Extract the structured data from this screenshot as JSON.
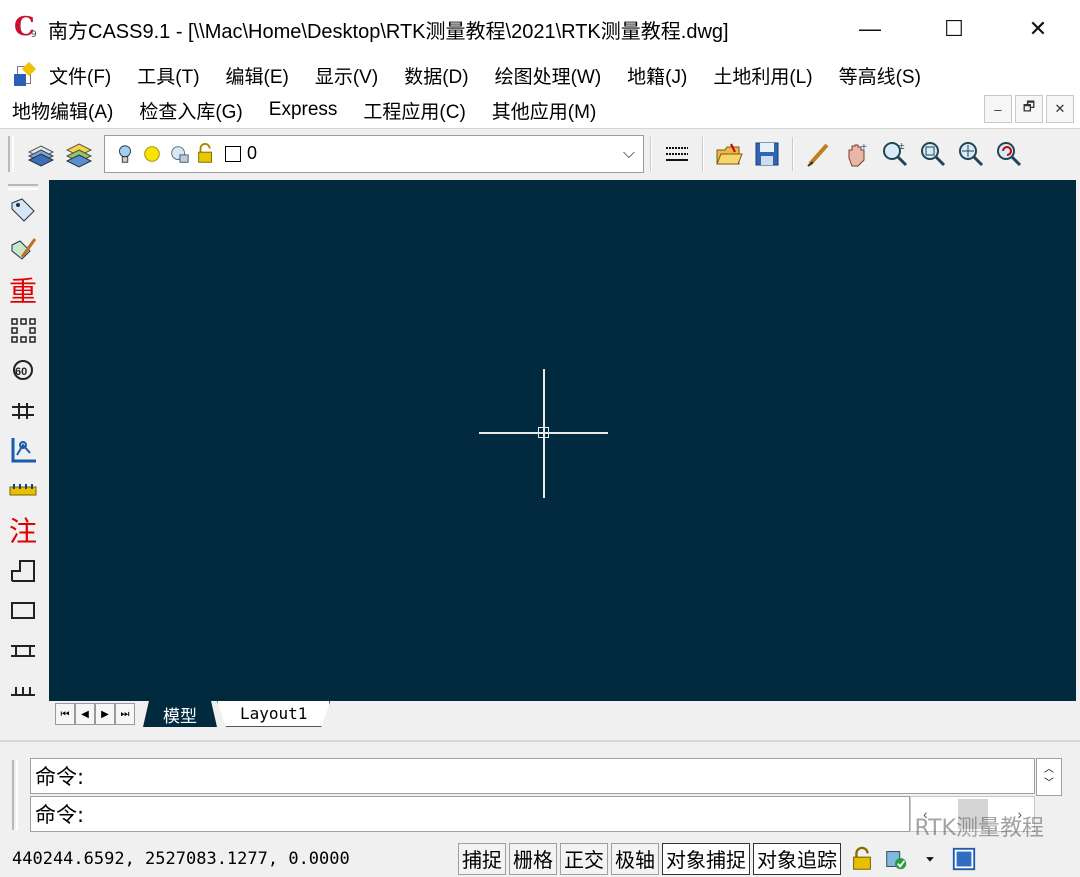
{
  "window": {
    "title": "南方CASS9.1 - [\\\\Mac\\Home\\Desktop\\RTK测量教程\\2021\\RTK测量教程.dwg]",
    "minimize": "—",
    "maximize": "☐",
    "close": "✕"
  },
  "menu": {
    "row1": [
      "文件(F)",
      "工具(T)",
      "编辑(E)",
      "显示(V)",
      "数据(D)",
      "绘图处理(W)",
      "地籍(J)",
      "土地利用(L)",
      "等高线(S)"
    ],
    "row2": [
      "地物编辑(A)",
      "检查入库(G)",
      "Express",
      "工程应用(C)",
      "其他应用(M)"
    ]
  },
  "mdi": {
    "minimize": "–",
    "restore": "🗗",
    "close": "✕"
  },
  "toolbar": {
    "layer_value": "0",
    "dropdown_arrow": "⌵"
  },
  "left_toolbar": {
    "char_redraw": "重",
    "char_annotate": "注"
  },
  "tabs": {
    "nav": [
      "⏮",
      "◀",
      "▶",
      "⏭"
    ],
    "model": "模型",
    "layout1": "Layout1"
  },
  "command": {
    "line1": "命令:",
    "line2": "命令:"
  },
  "status": {
    "coordinates": "440244.6592,  2527083.1277,  0.0000",
    "buttons": [
      {
        "label": "捕捉",
        "on": false
      },
      {
        "label": "栅格",
        "on": false
      },
      {
        "label": "正交",
        "on": false
      },
      {
        "label": "极轴",
        "on": false
      },
      {
        "label": "对象捕捉",
        "on": true
      },
      {
        "label": "对象追踪",
        "on": true
      }
    ]
  },
  "watermark": "RTK测量教程",
  "colors": {
    "canvas": "#022a3f",
    "crosshair": "#e8e8e8",
    "app_icon_red": "#c8102e"
  }
}
